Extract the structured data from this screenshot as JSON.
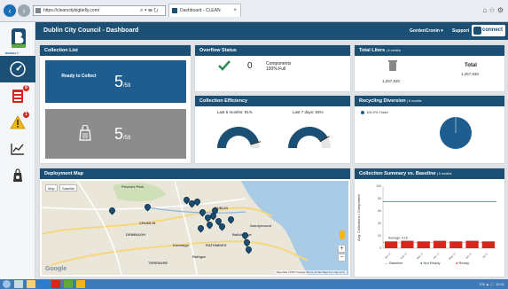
{
  "browser": {
    "url": "https://cleancitybigbelly.com/",
    "search_hint": "⌕ ▾ ☰ ⭮",
    "tab_title": "Dashboard - CLEAN",
    "tab_close": "×",
    "window_controls": "⌂ ☆ ⚙"
  },
  "sidebar": {
    "logo_text": "BIGBELLY",
    "items": [
      {
        "name": "dashboard",
        "badge": ""
      },
      {
        "name": "bins",
        "badge": "8"
      },
      {
        "name": "alerts",
        "badge": "1"
      },
      {
        "name": "reports",
        "badge": ""
      },
      {
        "name": "recycling",
        "badge": ""
      }
    ]
  },
  "header": {
    "title": "Dublin City Council - Dashboard",
    "user": "GordenCronin ▾",
    "support": "Support",
    "connect": "connect"
  },
  "collection_list": {
    "title": "Collection List",
    "ready_label": "Ready to Collect",
    "ready_count": "5",
    "ready_total": "/59",
    "other_count": "5",
    "other_total": "/59"
  },
  "overflow": {
    "title": "Overflow Status",
    "count": "0",
    "line1": "Components",
    "line2": "100% Full"
  },
  "total_liters": {
    "title": "Total Liters",
    "subtitle": "| 6 months",
    "left_value": "1,257,930",
    "total_label": "Total",
    "total_value": "1,257,930"
  },
  "efficiency": {
    "title": "Collection Efficiency",
    "left_label": "Last 6 months: 91%",
    "right_label": "Last 7 days: 83%",
    "left_pct": 91,
    "right_pct": 83
  },
  "recycling": {
    "title": "Recycling Diversion",
    "subtitle": "| 6 months",
    "legend": "100.0% Trash"
  },
  "map": {
    "title": "Deployment Map",
    "btn_map": "Map",
    "btn_satellite": "Satellite",
    "labels": [
      "Phoenix Park",
      "DUBLIN",
      "CRUMLIN",
      "DRIMNAGH",
      "TERENURE",
      "RATHMINES",
      "Ballsbridge",
      "Sandymount",
      "Rathgar",
      "Kimmage"
    ],
    "google": "Google",
    "footer": "Map data ©2017 Google   Terms of Use   Report a map error",
    "zoom_in": "+",
    "zoom_out": "−"
  },
  "summary": {
    "title": "Collection Summary vs. Baseline",
    "subtitle": "| 6 months",
    "legend_baseline": "Baseline",
    "legend_not_ready": "Not Ready",
    "legend_ready": "Ready"
  },
  "chart_data": {
    "type": "bar",
    "title": "Collection Summary vs. Baseline",
    "ylabel": "Avg. Collections / Component",
    "ylim": [
      0,
      100
    ],
    "yticks": [
      "0",
      "20",
      "40",
      "60",
      "80",
      "100"
    ],
    "categories": [
      "Jan 17",
      "Feb 17",
      "Mar 17",
      "Apr 17",
      "May 17",
      "Jun 17",
      "Jul 17"
    ],
    "series": [
      {
        "name": "Baseline",
        "type": "line",
        "values": [
          75,
          75,
          75,
          75,
          75,
          75,
          75
        ],
        "color": "#2e8b57"
      },
      {
        "name": "Not Ready",
        "values": [
          0,
          0,
          0,
          0,
          0,
          0,
          0
        ],
        "color": "#1f5d8f"
      },
      {
        "name": "Ready",
        "values": [
          11,
          12,
          11,
          12,
          11,
          12,
          11
        ],
        "color": "#d9261c"
      }
    ],
    "annotation": "Average: 9.16",
    "annotation_value": 9.16
  },
  "colors": {
    "brand": "#1b4f73",
    "ready": "#d9261c",
    "accent": "#1f5d8f"
  },
  "taskbar": {
    "tray": "EN  ▲  🔊  12:21"
  }
}
